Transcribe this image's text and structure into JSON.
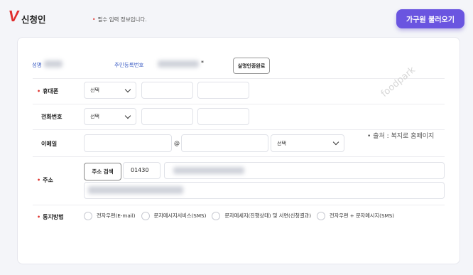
{
  "header": {
    "title": "신청인",
    "required_note": "필수 입력 정보입니다.",
    "required_dot": "•",
    "load_family_label": "가구원 불러오기"
  },
  "identity": {
    "name_label": "성명",
    "rrn_label": "주민등록번호",
    "rrn_suffix": "*",
    "verify_label": "실명인증완료"
  },
  "form": {
    "mobile": {
      "label": "휴대폰",
      "required": true,
      "select_value": "선택"
    },
    "phone": {
      "label": "전화번호",
      "required": false,
      "select_value": "선택"
    },
    "email": {
      "label": "이메일",
      "required": false,
      "at_sign": "@",
      "select_value": "선택"
    },
    "address": {
      "label": "주소",
      "required": true,
      "search_label": "주소 검색",
      "zipcode": "01430"
    },
    "notify": {
      "label": "통지방법",
      "required": true,
      "options": [
        "전자우편(E-mail)",
        "문자메시지서비스(SMS)",
        "문자메세지(진행상태) 및 서면(신청결과)",
        "전자우편 + 문자메시지(SMS)"
      ]
    }
  },
  "overlay": {
    "watermark": "foodpark",
    "source_note": "• 출처 : 복지로 홈페이지"
  },
  "colors": {
    "accent": "#6a55e0",
    "required": "#e0342f",
    "label_blue": "#3b5cc4"
  }
}
